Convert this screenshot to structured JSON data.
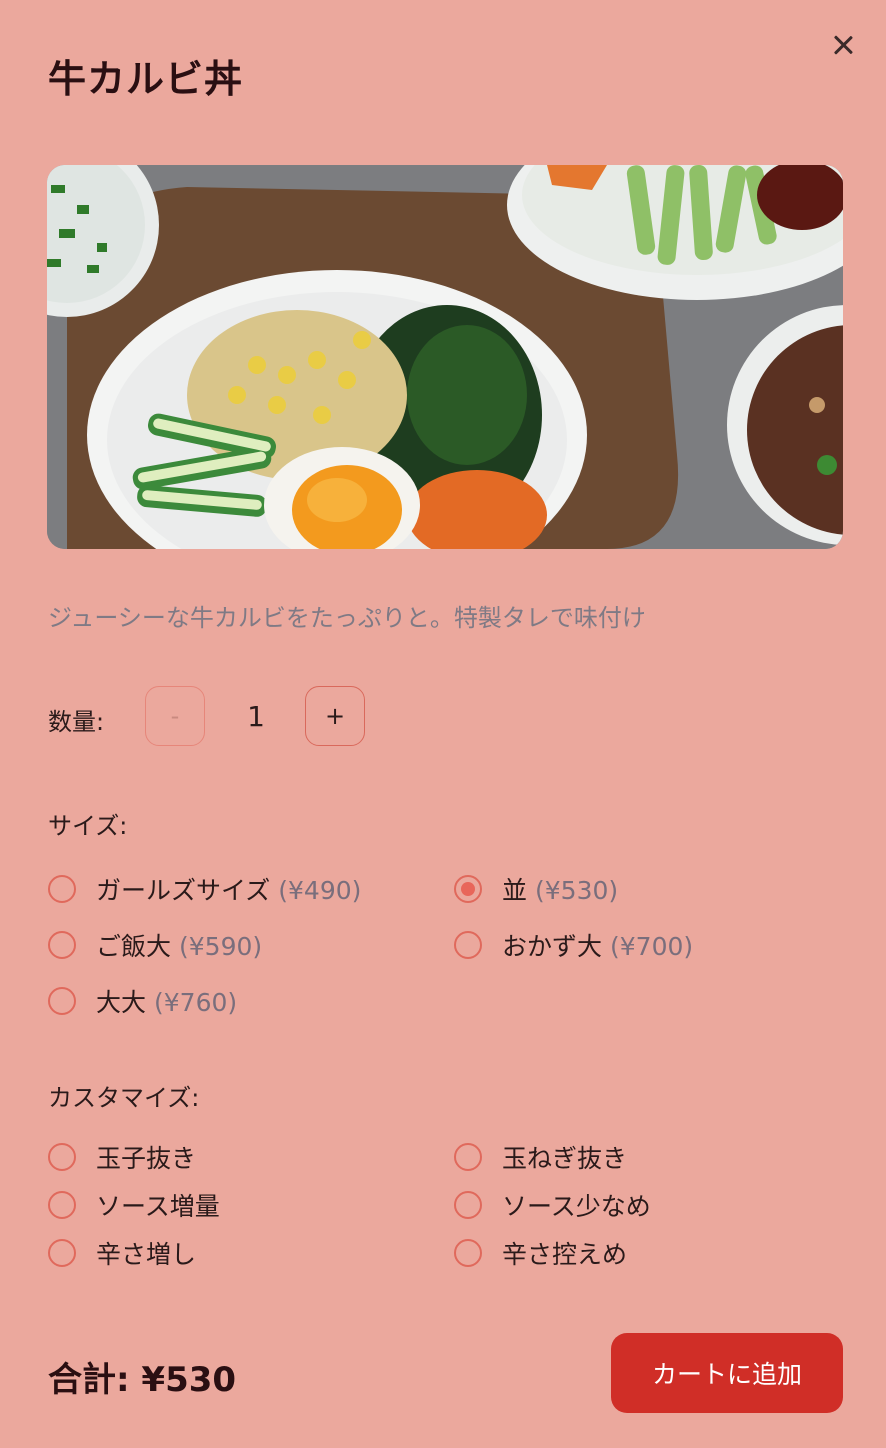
{
  "dialog": {
    "title": "牛カルビ丼",
    "description": "ジューシーな牛カルビをたっぷりと。特製タレで味付け"
  },
  "quantity": {
    "label": "数量:",
    "minus_label": "-",
    "plus_label": "+",
    "value": "1"
  },
  "size": {
    "label": "サイズ:",
    "options": [
      {
        "name": "ガールズサイズ",
        "price": "(¥490)",
        "selected": false
      },
      {
        "name": "並",
        "price": "(¥530)",
        "selected": true
      },
      {
        "name": "ご飯大",
        "price": "(¥590)",
        "selected": false
      },
      {
        "name": "おかず大",
        "price": "(¥700)",
        "selected": false
      },
      {
        "name": "大大",
        "price": "(¥760)",
        "selected": false
      }
    ]
  },
  "customize": {
    "label": "カスタマイズ:",
    "options": [
      {
        "name": "玉子抜き",
        "selected": false
      },
      {
        "name": "玉ねぎ抜き",
        "selected": false
      },
      {
        "name": "ソース増量",
        "selected": false
      },
      {
        "name": "ソース少なめ",
        "selected": false
      },
      {
        "name": "辛さ増し",
        "selected": false
      },
      {
        "name": "辛さ控えめ",
        "selected": false
      }
    ]
  },
  "footer": {
    "total": "合計: ¥530",
    "add_to_cart": "カートに追加"
  },
  "colors": {
    "background": "#eba89d",
    "accent": "#d02e27",
    "radio": "#e0695c"
  },
  "icons": {
    "close": "close-icon"
  }
}
